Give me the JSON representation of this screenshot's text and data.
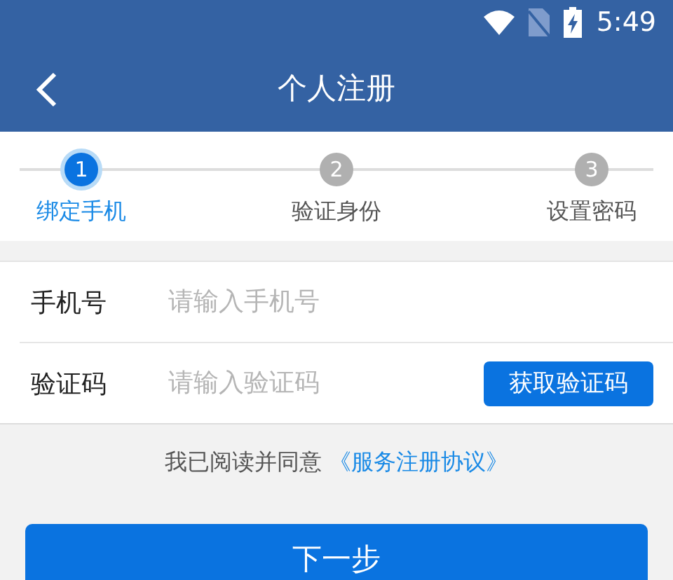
{
  "status_bar": {
    "time": "5:49"
  },
  "toolbar": {
    "title": "个人注册"
  },
  "steps": [
    {
      "number": "1",
      "label": "绑定手机",
      "selected": true
    },
    {
      "number": "2",
      "label": "验证身份",
      "selected": false
    },
    {
      "number": "3",
      "label": "设置密码",
      "selected": false
    }
  ],
  "fields": [
    {
      "label": "手机号",
      "placeholder": "请输入手机号"
    },
    {
      "label": "验证码",
      "placeholder": "请输入验证码",
      "button": "获取验证码"
    }
  ],
  "agreement": {
    "text": "我已阅读并同意",
    "link": "《服务注册协议》"
  },
  "submit_button": "下一步"
}
